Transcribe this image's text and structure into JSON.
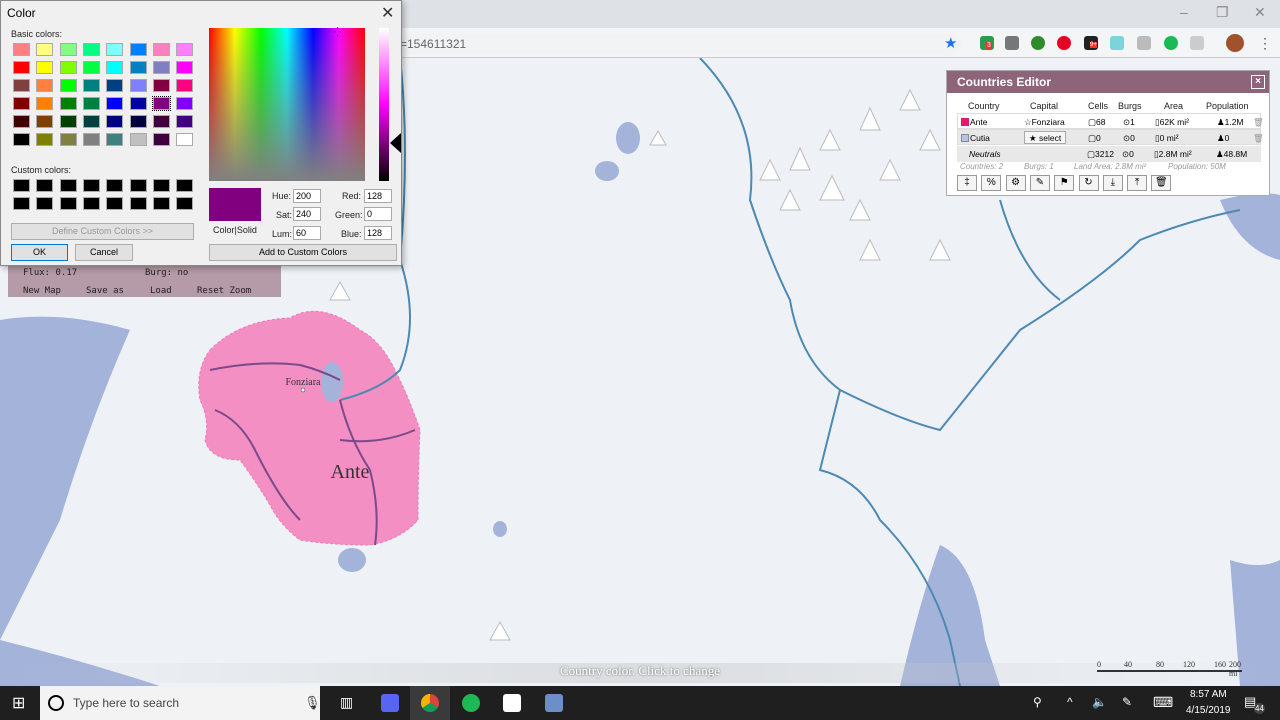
{
  "browser": {
    "address": "=154611321",
    "minimize": "–",
    "restore": "❐",
    "close": "✕",
    "menu": "⋮",
    "extension_badges": [
      "3",
      "9+"
    ]
  },
  "map": {
    "burg_label": "Fonziara",
    "country_label": "Ante",
    "country_color": "#f48fc4",
    "water_color": "#a4b3da",
    "river_color": "#4d89b2",
    "land_color": "#eef2f7"
  },
  "menu_panel": {
    "flux": "Flux: 0.17",
    "burg": "Burg: no",
    "buttons": [
      "New Map",
      "Save as",
      "Load",
      "Reset Zoom"
    ]
  },
  "color_dialog": {
    "title": "Color",
    "close": "✕",
    "basic_label": "Basic colors:",
    "custom_label": "Custom colors:",
    "basic_colors": [
      "#ff8080",
      "#ffff80",
      "#80ff80",
      "#00ff80",
      "#80ffff",
      "#0080ff",
      "#ff80c0",
      "#ff80ff",
      "#ff0000",
      "#ffff00",
      "#80ff00",
      "#00ff40",
      "#00ffff",
      "#0080c0",
      "#8080c0",
      "#ff00ff",
      "#804040",
      "#ff8040",
      "#00ff00",
      "#008080",
      "#004080",
      "#8080ff",
      "#800040",
      "#ff0080",
      "#800000",
      "#ff8000",
      "#008000",
      "#008040",
      "#0000ff",
      "#0000a0",
      "#800080",
      "#8000ff",
      "#400000",
      "#804000",
      "#004000",
      "#004040",
      "#000080",
      "#000040",
      "#400040",
      "#400080",
      "#000000",
      "#808000",
      "#808040",
      "#808080",
      "#408080",
      "#c0c0c0",
      "#400040",
      "#ffffff"
    ],
    "selected_index": 30,
    "custom_colors": [
      "#000000",
      "#000000",
      "#000000",
      "#000000",
      "#000000",
      "#000000",
      "#000000",
      "#000000",
      "#000000",
      "#000000",
      "#000000",
      "#000000",
      "#000000",
      "#000000",
      "#000000",
      "#000000"
    ],
    "define_custom": "Define Custom Colors >>",
    "ok": "OK",
    "cancel": "Cancel",
    "preview_color": "#800080",
    "color_solid": "Color|Solid",
    "hue_label": "Hue:",
    "hue": "200",
    "sat_label": "Sat:",
    "sat": "240",
    "lum_label": "Lum:",
    "lum": "60",
    "red_label": "Red:",
    "red": "128",
    "green_label": "Green:",
    "green": "0",
    "blue_label": "Blue:",
    "blue": "128",
    "add_custom": "Add to Custom Colors"
  },
  "countries_editor": {
    "title": "Countries Editor",
    "close": "×",
    "headers": [
      "Country",
      "Capital",
      "Cells",
      "Burgs",
      "Area",
      "Population"
    ],
    "rows": [
      {
        "color": "#e6186e",
        "name": "Ante",
        "capital": "☆Fonziara",
        "cells": "▢68",
        "burgs": "⊙1",
        "area": "▯62K mi²",
        "population": "♟1.2M"
      },
      {
        "color": "#b5c3e6",
        "name": "Cutia",
        "capital": "★ select",
        "cells": "▢0",
        "burgs": "⊙0",
        "area": "▯0 mi²",
        "population": "♟0"
      },
      {
        "name": "Neutrals",
        "cells": "▢3212",
        "burgs": "⊙0",
        "area": "▯2.8M mi²",
        "population": "♟48.8M"
      }
    ],
    "footer": {
      "countries": "Countries: 2",
      "burgs": "Burgs: 1",
      "land_area": "Land Area: 2.8M mi²",
      "population": "Population: 50M"
    },
    "toolbar": [
      {
        "icon": "regenerate-icon",
        "glyph": "‡"
      },
      {
        "icon": "percent-icon",
        "glyph": "%"
      },
      {
        "icon": "gears-icon",
        "glyph": "⚙"
      },
      {
        "icon": "brush-icon",
        "glyph": "✎"
      },
      {
        "icon": "flag-icon",
        "glyph": "⚑"
      },
      {
        "icon": "refresh-icon",
        "glyph": "↻"
      },
      {
        "icon": "download-icon",
        "glyph": "⤓"
      },
      {
        "icon": "upload-icon",
        "glyph": "⤒"
      },
      {
        "icon": "trash-icon",
        "glyph": "🗑"
      }
    ]
  },
  "tooltip": "Country color. Click to change",
  "scale": {
    "ticks": [
      "0",
      "40",
      "80",
      "120",
      "160",
      "200 mi"
    ]
  },
  "taskbar": {
    "search_placeholder": "Type here to search",
    "time": "8:57 AM",
    "date": "4/15/2019",
    "notifications": "44"
  }
}
